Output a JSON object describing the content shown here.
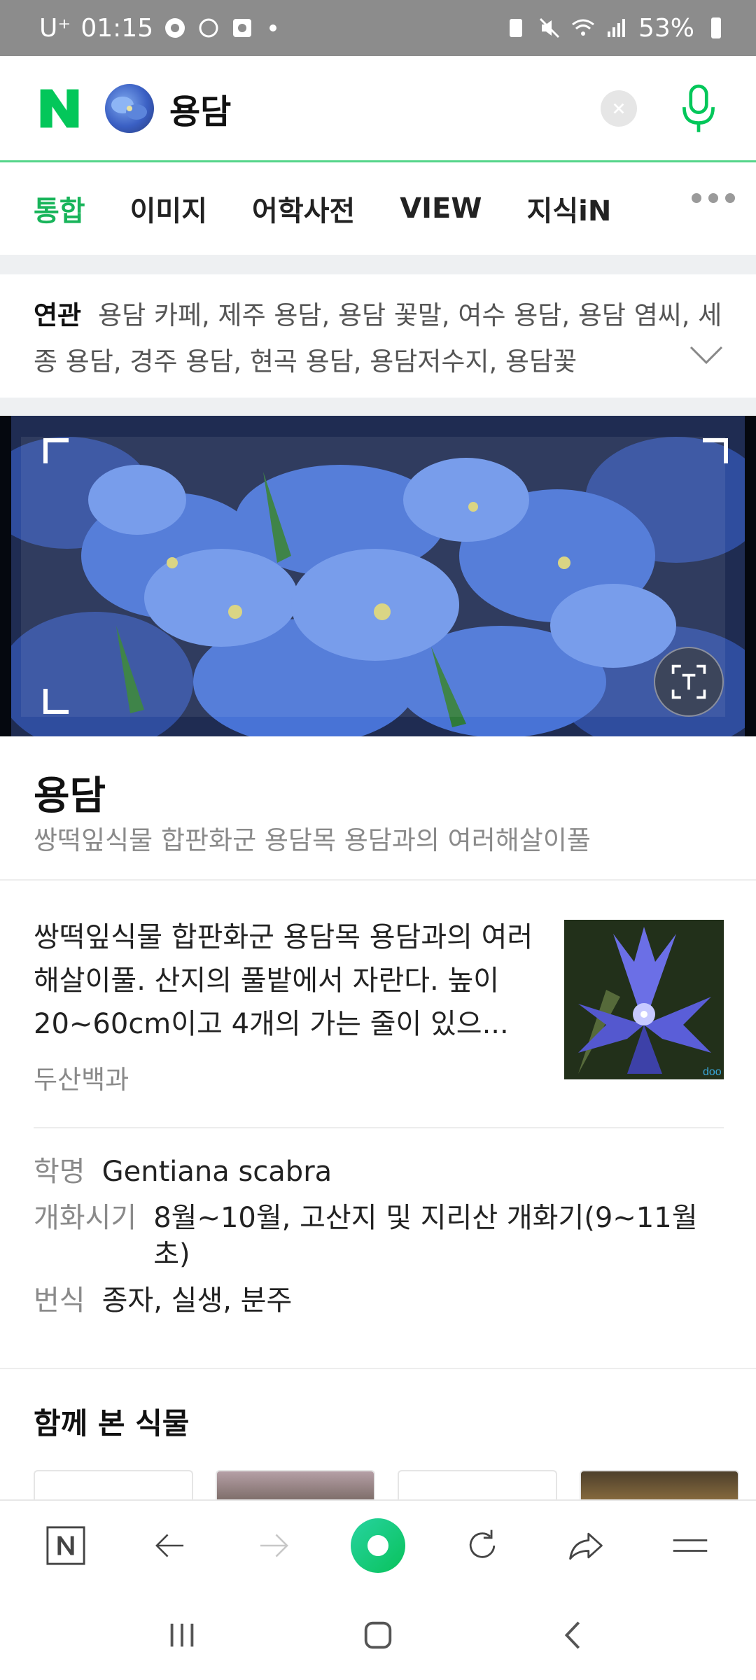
{
  "status_bar": {
    "carrier": "U⁺",
    "time": "01:15",
    "battery": "53%"
  },
  "search": {
    "query": "용담"
  },
  "tabs": [
    {
      "label": "통합",
      "active": true
    },
    {
      "label": "이미지",
      "active": false
    },
    {
      "label": "어학사전",
      "active": false
    },
    {
      "label": "VIEW",
      "active": false
    },
    {
      "label": "지식iN",
      "active": false
    }
  ],
  "related": {
    "label": "연관",
    "items_text": "용담 카페, 제주 용담, 용담 꽃말, 여수 용담, 용담 염씨, 세종 용담, 경주 용담, 현곡 용담, 용담저수지, 용담꽃"
  },
  "info": {
    "title": "용담",
    "subtitle": "쌍떡잎식물 합판화군 용담목 용담과의 여러해살이풀",
    "description": "쌍떡잎식물 합판화군 용담목 용담과의 여러해살이풀. 산지의 풀밭에서 자란다. 높이 20~60cm이고 4개의 가는 줄이 있으...",
    "source": "두산백과",
    "image_watermark": "doo",
    "properties": [
      {
        "key": "학명",
        "value": "Gentiana scabra"
      },
      {
        "key": "개화시기",
        "value": "8월~10월, 고산지 및 지리산 개화기(9~11월 초)"
      },
      {
        "key": "번식",
        "value": "종자, 실생, 분주"
      }
    ]
  },
  "together": {
    "title": "함께 본 식물"
  },
  "colors": {
    "naver_green": "#03c75a",
    "active_tab": "#18b45a",
    "status_bar": "#8c8c8c"
  }
}
